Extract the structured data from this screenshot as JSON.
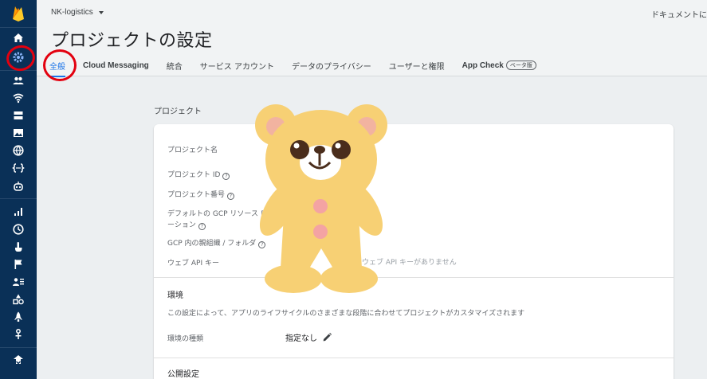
{
  "project": {
    "name": "NK-logistics"
  },
  "header": {
    "docs_link": "ドキュメントに",
    "title": "プロジェクトの設定"
  },
  "tabs": [
    {
      "label": "全般",
      "active": true
    },
    {
      "label": "Cloud Messaging"
    },
    {
      "label": "統合"
    },
    {
      "label": "サービス アカウント"
    },
    {
      "label": "データのプライバシー"
    },
    {
      "label": "ユーザーと権限"
    },
    {
      "label": "App Check",
      "badge": "ベータ版"
    }
  ],
  "content": {
    "section_heading": "プロジェクト",
    "rows": {
      "project_name": "プロジェクト名",
      "project_id": "プロジェクト ID",
      "project_number": "プロジェクト番号",
      "default_location_line1": "デフォルトの GCP リソース ロ",
      "default_location_line2": "ーション",
      "parent_folder": "GCP 内の親組織 / フォルダ",
      "web_api_key": "ウェブ API キー",
      "web_api_key_value": "ウェブ API キーがありません"
    },
    "environment": {
      "heading": "環境",
      "description": "この設定によって、アプリのライフサイクルのさまざまな段階に合わせてプロジェクトがカスタマイズされます",
      "type_label": "環境の種類",
      "type_value": "指定なし"
    },
    "public_settings": {
      "heading": "公開設定"
    }
  },
  "colors": {
    "sidebar": "#0a3057",
    "accent": "#1a73e8",
    "annotation": "#e3000f",
    "bear": "#f7d074"
  }
}
